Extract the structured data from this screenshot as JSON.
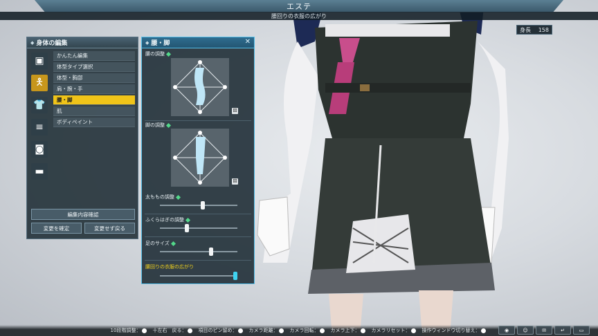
{
  "top": {
    "title": "エステ",
    "subtitle": "腰回りの衣服の広がり"
  },
  "height_display": {
    "label": "身長",
    "value": "158"
  },
  "body_panel": {
    "title": "身体の編集",
    "categories": [
      {
        "icon": "face-icon",
        "active": false
      },
      {
        "icon": "body-figure-icon",
        "active": true
      },
      {
        "icon": "costume-icon",
        "active": false
      },
      {
        "icon": "list-icon",
        "active": false
      },
      {
        "icon": "portrait-icon",
        "active": false
      },
      {
        "icon": "folder-icon",
        "active": false
      }
    ],
    "menu_items": [
      "かんたん編集",
      "体型タイプ選択",
      "体型・胸部",
      "肩・腕・手",
      "腰・脚",
      "肌",
      "ボディペイント"
    ],
    "active_menu_index": 4,
    "confirm_label": "編集内容確認",
    "apply_label": "変更を確定",
    "revert_label": "変更せず戻る"
  },
  "edit_panel": {
    "title": "腰・脚",
    "close_glyph": "✕",
    "waist_label": "腰の調整",
    "leg_label": "脚の調整",
    "sliders": [
      {
        "label": "太ももの調整",
        "value": 0.55,
        "highlight": false
      },
      {
        "label": "ふくらはぎの調整",
        "value": 0.35,
        "highlight": false
      },
      {
        "label": "足のサイズ",
        "value": 0.66,
        "highlight": false
      },
      {
        "label": "腰回りの衣服の広がり",
        "value": 0.97,
        "highlight": true
      }
    ]
  },
  "bottom_bar": {
    "items": [
      "10段階調整：",
      "十左右　戻る：",
      "項目のピン留め：",
      "カメラ距離：",
      "カメラ回転：",
      "カメラ上下：",
      "カメラリセット：",
      "操作ウィンドウ切り替え："
    ]
  },
  "colors": {
    "accent": "#f0c419",
    "panel_border": "#58c2ec",
    "highlight_knob": "#3fd3f0"
  }
}
